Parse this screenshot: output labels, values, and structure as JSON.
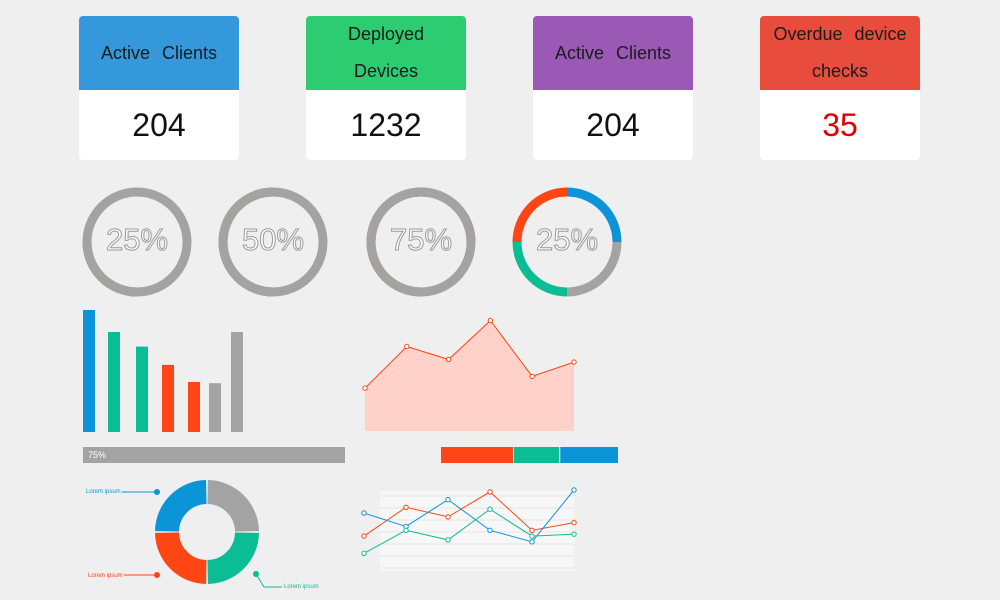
{
  "cards": [
    {
      "title": "Active  Clients",
      "value": "204",
      "color": "#3498db",
      "value_color": "#111111"
    },
    {
      "title": "Deployed Devices",
      "value": "1232",
      "color": "#2ecc71",
      "value_color": "#111111"
    },
    {
      "title": "Active  Clients",
      "value": "204",
      "color": "#9b59b6",
      "value_color": "#111111"
    },
    {
      "title": "Overdue  device checks",
      "value": "35",
      "color": "#e74c3c",
      "value_color": "#e00000"
    }
  ],
  "rings": [
    {
      "label": "25%",
      "percent": 25
    },
    {
      "label": "50%",
      "percent": 50
    },
    {
      "label": "75%",
      "percent": 75
    },
    {
      "label": "25%",
      "segments": [
        25,
        25,
        25,
        25
      ]
    }
  ],
  "progress": {
    "label": "75%",
    "percent": 75
  },
  "segment_bar": [
    0.41,
    0.26,
    0.33
  ],
  "legend_labels": [
    "Lorem ipsum",
    "Lorem ipsum",
    "Lorem ipsum"
  ],
  "colors": {
    "blue": "#0b94d8",
    "green": "#0bbd94",
    "orange": "#fd4614",
    "grey": "#a3a3a3",
    "area_fill": "#ffd2c9"
  },
  "chart_data": [
    {
      "type": "bar",
      "values": [
        100,
        82,
        70,
        55,
        41,
        40,
        82
      ],
      "colors": [
        "blue",
        "green",
        "green",
        "orange",
        "orange",
        "grey",
        "grey"
      ]
    },
    {
      "type": "area",
      "values": [
        33,
        65,
        55,
        85,
        42,
        53
      ]
    },
    {
      "type": "pie",
      "values": [
        25,
        25,
        25,
        25
      ]
    },
    {
      "type": "line",
      "series": [
        {
          "color": "orange",
          "values": [
            52,
            82,
            72,
            98,
            58,
            66
          ]
        },
        {
          "color": "blue",
          "values": [
            76,
            62,
            90,
            58,
            46,
            100
          ]
        },
        {
          "color": "green",
          "values": [
            34,
            58,
            48,
            80,
            52,
            54
          ]
        }
      ]
    }
  ]
}
